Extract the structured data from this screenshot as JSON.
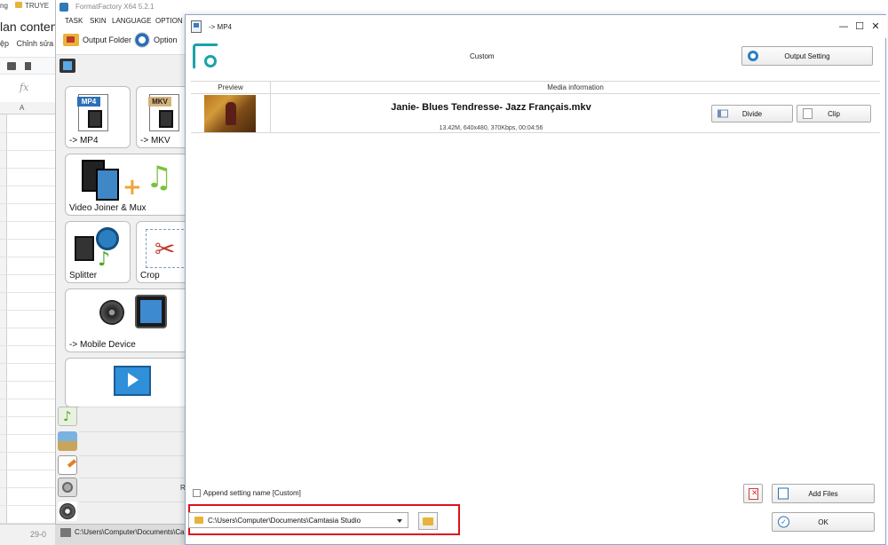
{
  "background_sheet": {
    "tabs": [
      "ng",
      "TRUYE"
    ],
    "doc_title": "lan content",
    "menu": [
      "ệp",
      "Chỉnh sửa"
    ],
    "fx_symbol": "fx",
    "column_header": "A",
    "bottom_date": "29-0"
  },
  "ff_main": {
    "title": "FormatFactory X64 5.2.1",
    "menu": [
      "TASK",
      "SKIN",
      "LANGUAGE",
      "OPTION"
    ],
    "toolbar": {
      "output_folder": "Output Folder",
      "option": "Option"
    },
    "tiles": [
      {
        "label": "-> MP4",
        "icon_text": "MP4"
      },
      {
        "label": "-> MKV",
        "icon_text": "MKV"
      },
      {
        "label": "Video Joiner & Mux"
      },
      {
        "label": "Splitter"
      },
      {
        "label": "Crop"
      },
      {
        "label": "-> Mobile Device"
      }
    ],
    "side_letter": "R",
    "status_path": "C:\\Users\\Computer\\Documents\\Cam"
  },
  "dialog": {
    "title": "-> MP4",
    "profile": "Custom",
    "output_setting": "Output Setting",
    "table_headers": {
      "preview": "Preview",
      "media_info": "Media information"
    },
    "file": {
      "name": "Janie- Blues Tendresse- Jazz Français.mkv",
      "info": "13.42M, 640x480, 370Kbps, 00:04:56",
      "divide": "Divide",
      "clip": "Clip"
    },
    "append_setting": "Append setting name [Custom]",
    "add_files": "Add Files",
    "output_path": "C:\\Users\\Computer\\Documents\\Camtasia Studio",
    "ok": "OK",
    "window_buttons": {
      "minimize": "—",
      "maximize": "☐",
      "close": "✕"
    }
  },
  "colors": {
    "accent": "#19a3a8",
    "highlight_box": "#e0101d",
    "folder": "#e8b33a"
  }
}
